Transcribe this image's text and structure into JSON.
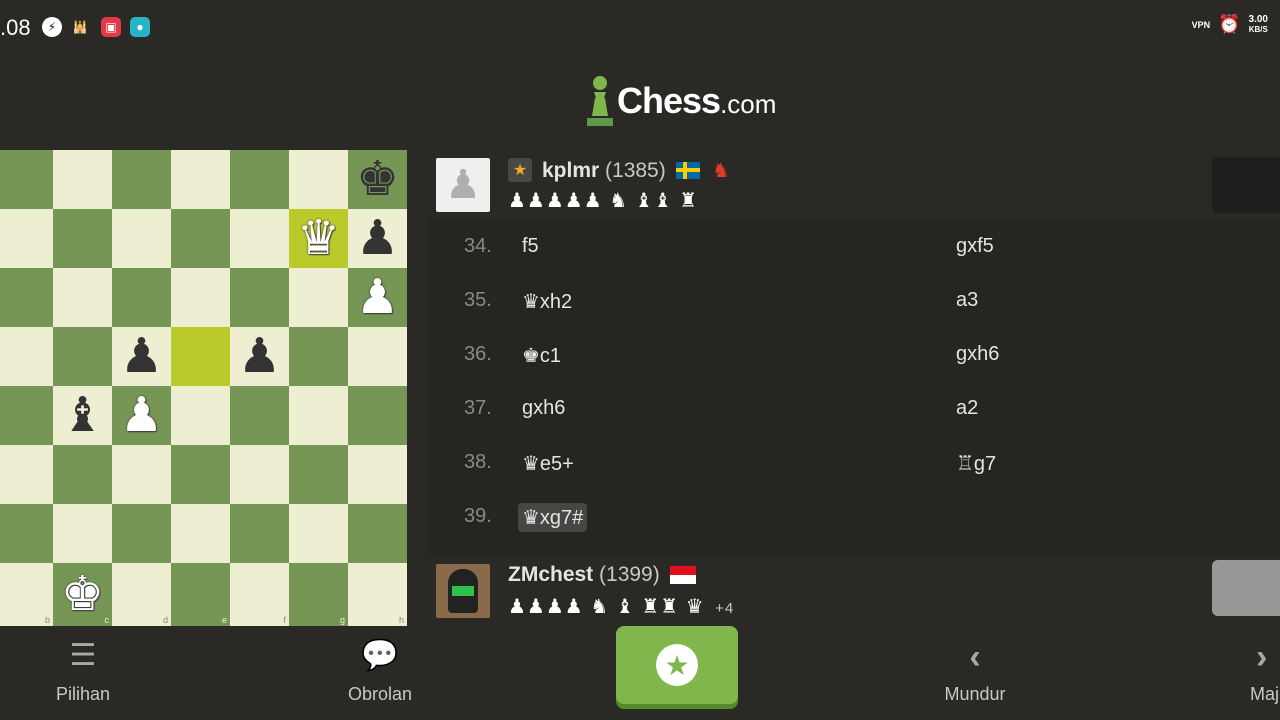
{
  "status_bar": {
    "time": ".08",
    "network_speed_value": "3.00",
    "network_speed_unit": "KB/S",
    "vpn_label": "VPN"
  },
  "app": {
    "logo_text": "Chess",
    "logo_suffix": ".com"
  },
  "board": {
    "files": [
      "b",
      "c",
      "d",
      "e",
      "f",
      "g",
      "h"
    ]
  },
  "top_player": {
    "name": "kplmr",
    "rating": "(1385)",
    "captured": "♟♟♟♟♟ ♞ ♝♝ ♜"
  },
  "bottom_player": {
    "name": "ZMchest",
    "rating": "(1399)",
    "captured": "♟♟♟♟ ♞ ♝ ♜♜ ♛",
    "material_diff": "+4"
  },
  "moves": [
    {
      "num": "34.",
      "white": "f5",
      "black": "gxf5"
    },
    {
      "num": "35.",
      "white": "♛xh2",
      "black": "a3"
    },
    {
      "num": "36.",
      "white": "♚c1",
      "black": "gxh6"
    },
    {
      "num": "37.",
      "white": "gxh6",
      "black": "a2"
    },
    {
      "num": "38.",
      "white": "♛e5+",
      "black": "♖g7"
    },
    {
      "num": "39.",
      "white": "♛xg7#",
      "black": ""
    }
  ],
  "nav": {
    "options": "Pilihan",
    "chat": "Obrolan",
    "back": "Mundur",
    "forward": "Maj"
  },
  "colors": {
    "board_light": "#eeeed2",
    "board_dark": "#769656",
    "highlight": "#baca2b",
    "accent_green": "#81b64c"
  }
}
